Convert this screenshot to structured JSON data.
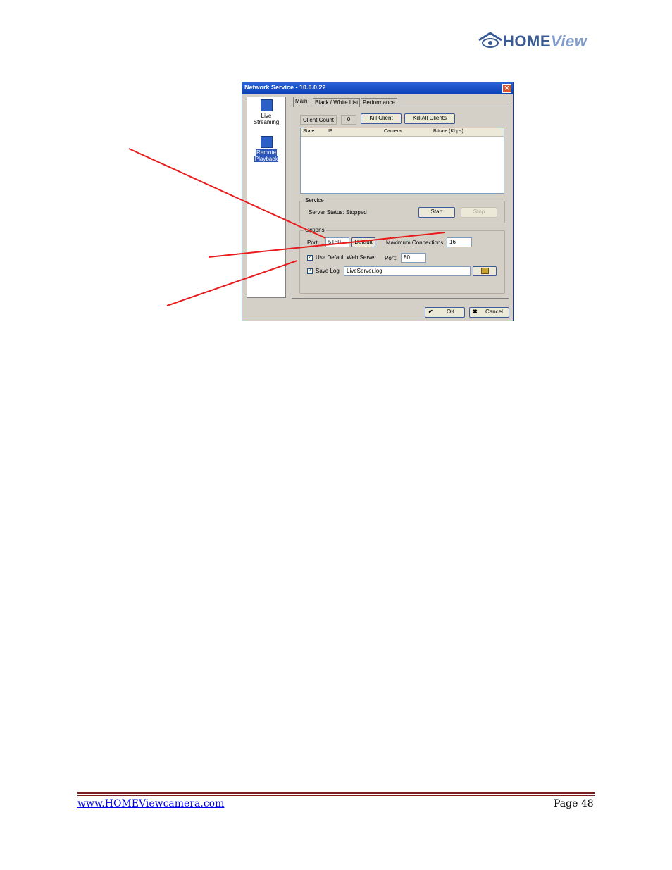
{
  "logo": {
    "home": "HOME",
    "view": "View"
  },
  "dialog": {
    "title": "Network Service - 10.0.0.22",
    "nav": [
      {
        "label_line1": "Live",
        "label_line2": "Streaming",
        "icon": "live-streaming-icon"
      },
      {
        "label_line1": "Remote",
        "label_line2": "Playback",
        "icon": "remote-playback-icon"
      }
    ],
    "tabs": [
      "Main",
      "Black / White List",
      "Performance"
    ],
    "client_count_label": "Client Count",
    "client_count_value": "0",
    "kill_client": "Kill Client",
    "kill_all_clients": "Kill All Clients",
    "columns": [
      "State",
      "IP",
      "Camera",
      "Bitrate (Kbps)"
    ],
    "service": {
      "title": "Service",
      "status": "Server Status: Stopped",
      "start": "Start",
      "stop": "Stop"
    },
    "options": {
      "title": "Options",
      "port_label": "Port",
      "port_value": "5150",
      "default_button": "Default",
      "max_conn_label": "Maximum Connections:",
      "max_conn_value": "16",
      "use_default_web_server": "Use Default Web Server",
      "web_port_label": "Port:",
      "web_port_value": "80",
      "save_log": "Save Log",
      "log_file": "LiveServer.log"
    },
    "ok": "OK",
    "cancel": "Cancel"
  },
  "footer": {
    "link": "www.HOMEViewcamera.com",
    "page": "Page 48"
  },
  "colors": {
    "arrow": "#e81c1c",
    "footer_rule": "#7a1f1f",
    "title_bar": "#0b3fb4"
  }
}
